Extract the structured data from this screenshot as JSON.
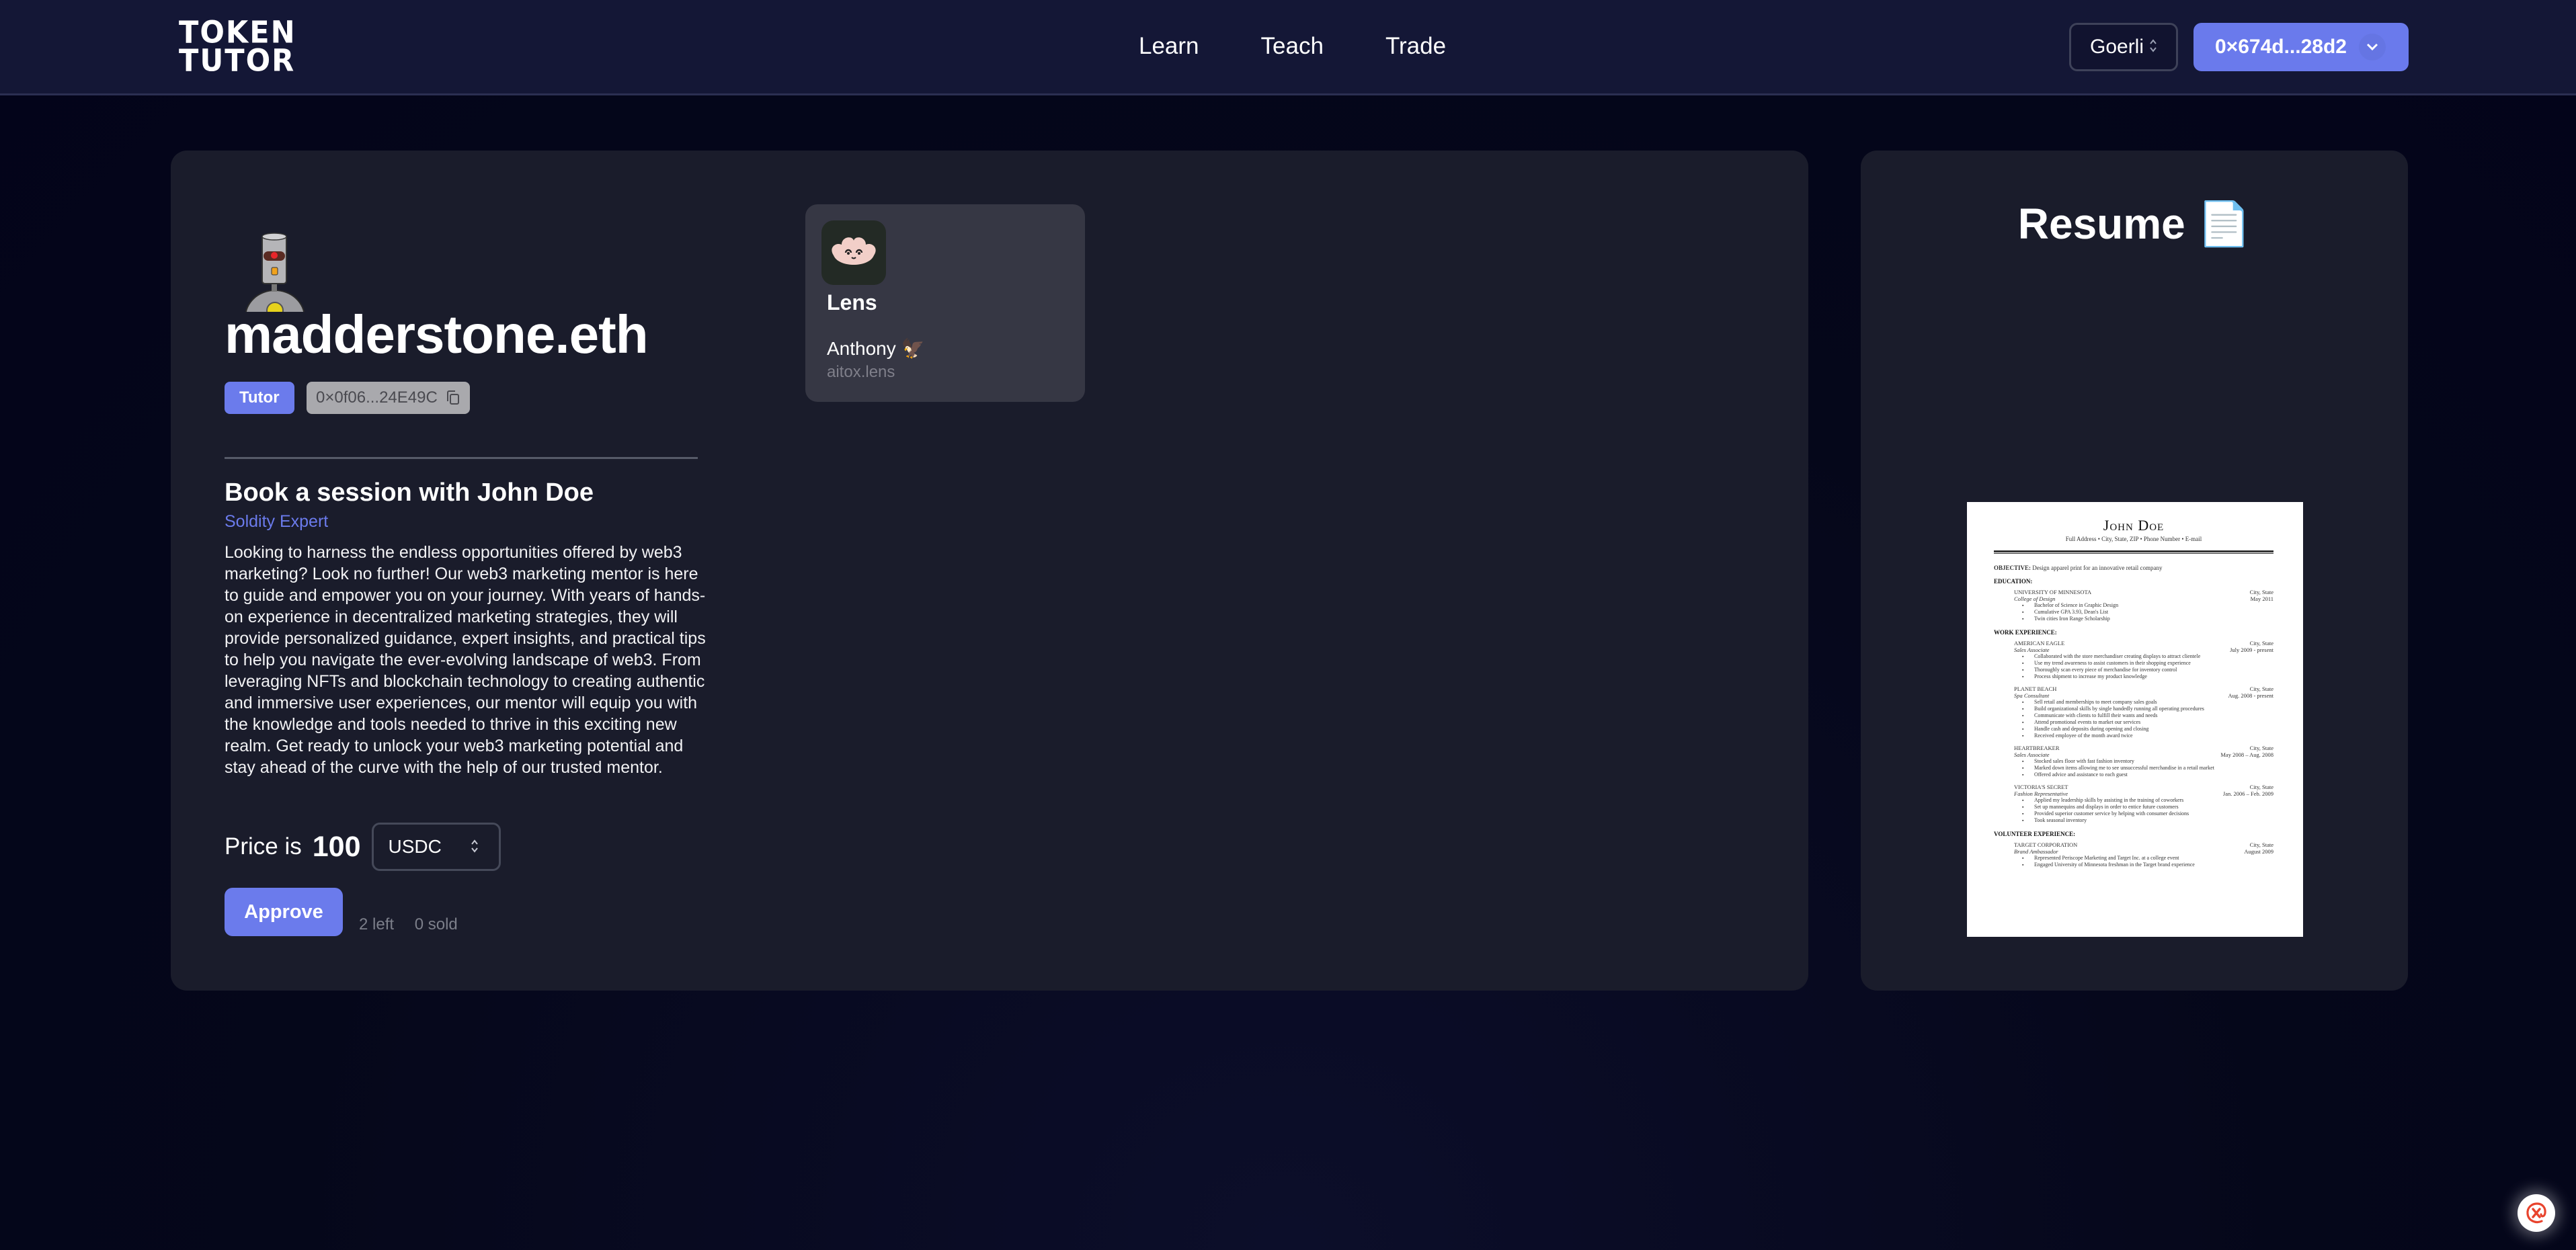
{
  "navbar": {
    "logo_line1": "TOKEN",
    "logo_line2": "TUTOR",
    "links": [
      "Learn",
      "Teach",
      "Trade"
    ],
    "network": "Goerli",
    "account": "0×674d...28d2"
  },
  "profile": {
    "username": "madderstone.eth",
    "role_badge": "Tutor",
    "address": "0×0f06...24E49C"
  },
  "session": {
    "title": "Book a session with John Doe",
    "subtitle": "Soldity Expert",
    "description": "Looking to harness the endless opportunities offered by web3 marketing? Look no further! Our web3 marketing mentor is here to guide and empower you on your journey. With years of hands-on experience in decentralized marketing strategies, they will provide personalized guidance, expert insights, and practical tips to help you navigate the ever-evolving landscape of web3. From leveraging NFTs and blockchain technology to creating authentic and immersive user experiences, our mentor will equip you with the knowledge and tools needed to thrive in this exciting new realm. Get ready to unlock your web3 marketing potential and stay ahead of the curve with the help of our trusted mentor.",
    "price_label": "Price is",
    "price_value": "100",
    "currency": "USDC",
    "approve_label": "Approve",
    "left_text": "2 left",
    "sold_text": "0 sold"
  },
  "lens": {
    "name": "Lens",
    "profile_name": "Anthony 🦅",
    "handle": "aitox.lens"
  },
  "resume": {
    "title": "Resume 📄",
    "doc": {
      "name": "John Doe",
      "contact": "Full Address • City, State, ZIP • Phone Number • E-mail",
      "objective_label": "OBJECTIVE:",
      "objective": "Design apparel print for an innovative retail company",
      "education_label": "EDUCATION:",
      "education": {
        "org": "UNIVERSITY OF MINNESOTA",
        "location": "City, State",
        "role": "College of Design",
        "date": "May 2011",
        "bullets": [
          "Bachelor of Science in Graphic Design",
          "Cumulative GPA 3.93, Dean's List",
          "Twin cities Iron Range Scholarship"
        ]
      },
      "work_label": "WORK EXPERIENCE:",
      "work": [
        {
          "org": "AMERICAN EAGLE",
          "location": "City, State",
          "role": "Sales Associate",
          "date": "July 2009 - present",
          "bullets": [
            "Collaborated with the store merchandiser creating displays to attract clientele",
            "Use my trend awareness to assist customers in their shopping experience",
            "Thoroughly scan every piece of merchandise for inventory control",
            "Process shipment to increase my product knowledge"
          ]
        },
        {
          "org": "PLANET BEACH",
          "location": "City, State",
          "role": "Spa Consultant",
          "date": "Aug. 2008 - present",
          "bullets": [
            "Sell retail and memberships to meet company sales goals",
            "Build organizational skills by single handedly running all operating procedures",
            "Communicate with clients to fulfill their wants and needs",
            "Attend promotional events to market our services",
            "Handle cash and deposits during opening and closing",
            "Received employee of the month award twice"
          ]
        },
        {
          "org": "HEARTBREAKER",
          "location": "City, State",
          "role": "Sales Associate",
          "date": "May 2008 – Aug. 2008",
          "bullets": [
            "Stocked sales floor with fast fashion inventory",
            "Marked down items allowing me to see unsuccessful merchandise in a retail market",
            "Offered advice and assistance to each guest"
          ]
        },
        {
          "org": "VICTORIA'S SECRET",
          "location": "City, State",
          "role": "Fashion Representative",
          "date": "Jan. 2006 – Feb. 2009",
          "bullets": [
            "Applied my leadership skills by assisting in the training of coworkers",
            "Set up mannequins and displays in order to entice future customers",
            "Provided superior customer service by helping with consumer decisions",
            "Took seasonal inventory"
          ]
        }
      ],
      "volunteer_label": "VOLUNTEER EXPERIENCE:",
      "volunteer": {
        "org": "TARGET CORPORATION",
        "location": "City, State",
        "role": "Brand Ambassador",
        "date": "August 2009",
        "bullets": [
          "Represented Periscope Marketing and Target Inc. at a college event",
          "Engaged University of Minnesota freshman in the Target brand experience"
        ]
      }
    }
  },
  "colors": {
    "accent": "#6b7bec",
    "card_bg": "#1a1c2b",
    "navbar_bg": "#141736",
    "lens_card_bg": "#363744"
  }
}
